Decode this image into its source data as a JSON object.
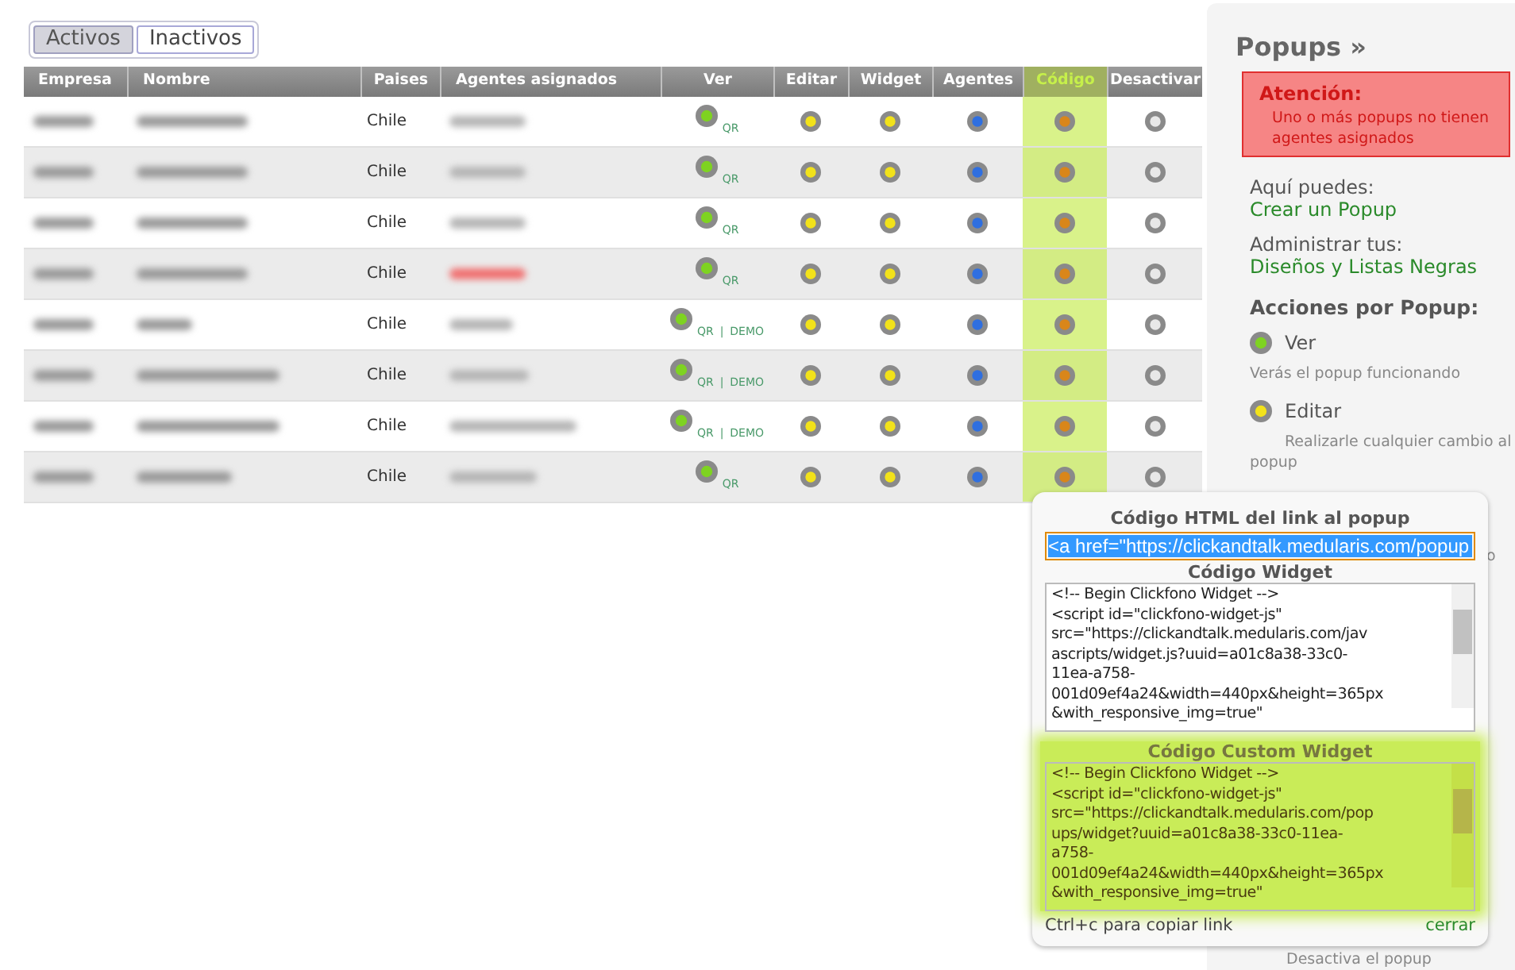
{
  "filter_tabs": [
    {
      "label": "Activos",
      "selected": true
    },
    {
      "label": "Inactivos",
      "selected": false
    }
  ],
  "table": {
    "columns": [
      {
        "label": "Empresa",
        "kind": "redacted",
        "highlighted": false
      },
      {
        "label": "Nombre",
        "kind": "redacted",
        "highlighted": false
      },
      {
        "label": "Paises",
        "kind": "country",
        "highlighted": false
      },
      {
        "label": "Agentes asignados",
        "kind": "agents",
        "highlighted": false
      },
      {
        "label": "Ver",
        "kind": "view",
        "color": "#7ed321",
        "highlighted": false
      },
      {
        "label": "Editar",
        "kind": "dot",
        "color": "#f2e21a",
        "highlighted": false
      },
      {
        "label": "Widget",
        "kind": "dot",
        "color": "#f2e21a",
        "highlighted": false
      },
      {
        "label": "Agentes",
        "kind": "dot",
        "color": "#2f6fe0",
        "highlighted": false
      },
      {
        "label": "Código",
        "kind": "dot",
        "color": "#d9861a",
        "highlighted": true
      },
      {
        "label": "Desactivar",
        "kind": "dot",
        "color": "#e8e8e8",
        "highlighted": false
      }
    ],
    "link_separator": "|",
    "rows": [
      {
        "country": "Chile",
        "agent_alert": false,
        "links": [
          "QR"
        ]
      },
      {
        "country": "Chile",
        "agent_alert": false,
        "links": [
          "QR"
        ]
      },
      {
        "country": "Chile",
        "agent_alert": false,
        "links": [
          "QR"
        ]
      },
      {
        "country": "Chile",
        "agent_alert": true,
        "links": [
          "QR"
        ]
      },
      {
        "country": "Chile",
        "agent_alert": false,
        "links": [
          "QR",
          "DEMO"
        ]
      },
      {
        "country": "Chile",
        "agent_alert": false,
        "links": [
          "QR",
          "DEMO"
        ]
      },
      {
        "country": "Chile",
        "agent_alert": false,
        "links": [
          "QR",
          "DEMO"
        ]
      },
      {
        "country": "Chile",
        "agent_alert": false,
        "links": [
          "QR"
        ]
      }
    ]
  },
  "sidebar": {
    "title": "Popups »",
    "alert": {
      "title": "Atención:",
      "text": "Uno o más popups no tienen agentes asignados"
    },
    "lines": [
      {
        "label": "Aquí puedes:",
        "link": "Crear un Popup"
      },
      {
        "label": "Administrar tus:",
        "link": "Diseños y Listas Negras"
      }
    ],
    "actions_title": "Acciones por Popup:",
    "actions": [
      {
        "label": "Ver",
        "color": "#7ed321",
        "description": "Verás el popup funcionando"
      },
      {
        "label": "Editar",
        "color": "#f2e21a",
        "description": "Realizarle cualquier cambio al popup"
      }
    ],
    "hidden_fragments": [
      "o",
      "Desactiva el popup"
    ]
  },
  "code_popup": {
    "link_title": "Código HTML del link al popup",
    "link_value": "<a href=\"https://clickandtalk.medularis.com/popup",
    "sections": [
      {
        "title": "Código Widget",
        "highlighted": false,
        "value": "<!-- Begin Clickfono Widget -->\n<script id=\"clickfono-widget-js\"\nsrc=\"https://clickandtalk.medularis.com/jav\nascripts/widget.js?uuid=a01c8a38-33c0-\n11ea-a758-\n001d09ef4a24&width=440px&height=365px\n&with_responsive_img=true\""
      },
      {
        "title": "Código Custom Widget",
        "highlighted": true,
        "value": "<!-- Begin Clickfono Widget -->\n<script id=\"clickfono-widget-js\"\nsrc=\"https://clickandtalk.medularis.com/pop\nups/widget?uuid=a01c8a38-33c0-11ea-\na758-\n001d09ef4a24&width=440px&height=365px\n&with_responsive_img=true\""
      }
    ],
    "hint": "Ctrl+c para copiar link",
    "close": "cerrar"
  }
}
